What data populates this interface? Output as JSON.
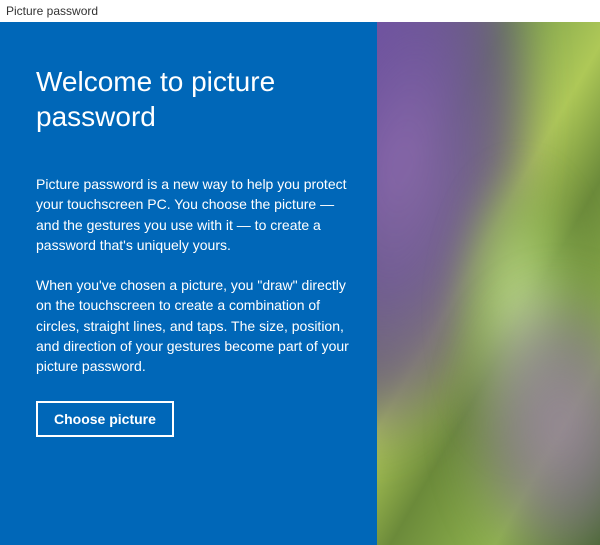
{
  "window": {
    "title": "Picture password"
  },
  "panel": {
    "heading": "Welcome to picture password",
    "paragraph1": "Picture password is a new way to help you protect your touchscreen PC. You choose the picture — and the gestures you use with it — to create a password that's uniquely yours.",
    "paragraph2": "When you've chosen a picture, you \"draw\" directly on the touchscreen to create a combination of circles, straight lines, and taps. The size, position, and direction of your gestures become part of your picture password.",
    "choose_button": "Choose picture"
  }
}
